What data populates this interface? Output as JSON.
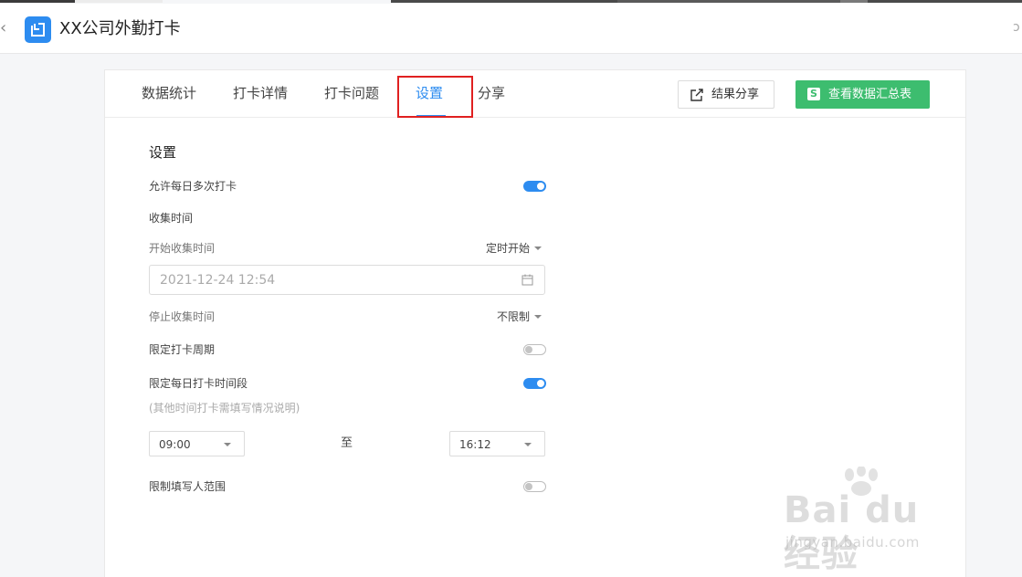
{
  "app": {
    "title": "XX公司外勤打卡",
    "back_glyph": "‹",
    "corner_glyph": "ↄ"
  },
  "tabs": [
    {
      "label": "数据统计",
      "active": false
    },
    {
      "label": "打卡详情",
      "active": false
    },
    {
      "label": "打卡问题",
      "active": false
    },
    {
      "label": "设置",
      "active": true
    },
    {
      "label": "分享",
      "active": false
    }
  ],
  "actions": {
    "share_label": "结果分享",
    "summary_label": "查看数据汇总表",
    "summary_icon": "S"
  },
  "settings": {
    "title": "设置",
    "allow_multiple": {
      "label": "允许每日多次打卡",
      "enabled": true
    },
    "collect_time_label": "收集时间",
    "start_collect": {
      "label": "开始收集时间",
      "mode": "定时开始",
      "datetime": "2021-12-24 12:54"
    },
    "stop_collect": {
      "label": "停止收集时间",
      "mode": "不限制"
    },
    "limit_period": {
      "label": "限定打卡周期",
      "enabled": false
    },
    "limit_daily_range": {
      "label": "限定每日打卡时间段",
      "enabled": true,
      "hint": "(其他时间打卡需填写情况说明)"
    },
    "time_range": {
      "start": "09:00",
      "separator": "至",
      "end": "16:12"
    },
    "limit_scope": {
      "label": "限制填写人范围",
      "enabled": false
    }
  },
  "watermark": {
    "main": "Bai du 经验",
    "sub": "jingyan.baidu.com"
  },
  "colors": {
    "accent": "#2d8cf0",
    "green": "#3dbd6f",
    "highlight": "#e02020"
  }
}
